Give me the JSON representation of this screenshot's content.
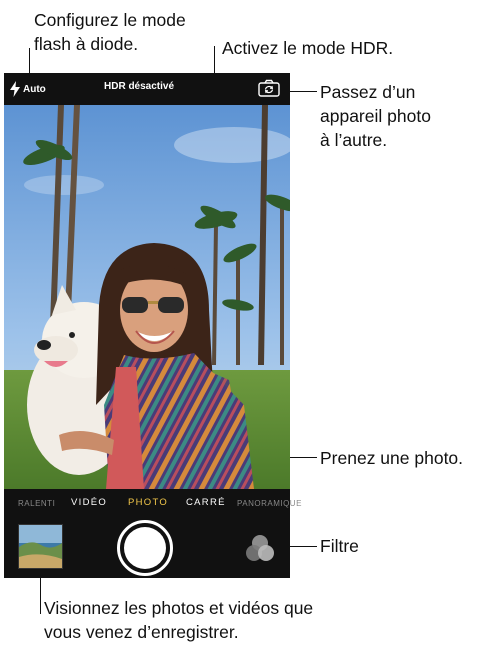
{
  "callouts": {
    "flash": "Configurez le mode\nflash à diode.",
    "flash_line1": "Configurez le mode",
    "flash_line2": "flash à diode.",
    "hdr": "Activez le mode HDR.",
    "switch_line1": "Passez d’un",
    "switch_line2": "appareil photo",
    "switch_line3": "à l’autre.",
    "shutter": "Prenez une photo.",
    "filter": "Filtre",
    "thumb_line1": "Visionnez les photos et vidéos que",
    "thumb_line2": "vous venez d’enregistrer."
  },
  "camera": {
    "flash_label": "Auto",
    "hdr_label": "HDR désactivé",
    "modes": [
      "RALENTI",
      "VIDÉO",
      "PHOTO",
      "CARRÉ",
      "PANORAMIQUE"
    ],
    "active_mode": "PHOTO"
  },
  "icons": {
    "flash": "lightning-bolt",
    "switch_camera": "camera-rotate",
    "filter": "overlapping-circles"
  },
  "colors": {
    "active_mode": "#f3c84a",
    "bar_background": "#111111",
    "callout_text": "#111111"
  }
}
